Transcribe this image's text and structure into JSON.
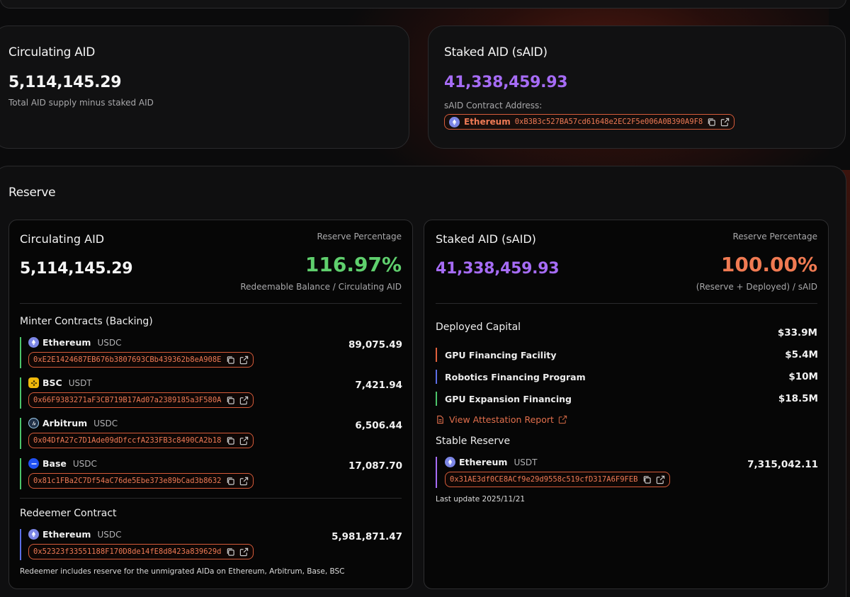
{
  "colors": {
    "accent": "#ee7a55",
    "purple": "#a66cf5",
    "green": "#5fcf6d",
    "orange": "#f07a52",
    "blue": "#5b6ee6"
  },
  "circulating_card": {
    "title": "Circulating AID",
    "value": "5,114,145.29",
    "caption": "Total AID supply minus staked AID"
  },
  "staked_card": {
    "title": "Staked AID (sAID)",
    "value": "41,338,459.93",
    "contract_label": "sAID Contract Address:",
    "chain": "Ethereum",
    "address": "0xB3B3c527BA57cd61648e2EC2F5e006A0B390A9F8"
  },
  "reserve": {
    "title": "Reserve",
    "left": {
      "title": "Circulating AID",
      "value": "5,114,145.29",
      "pct_label": "Reserve Percentage",
      "pct": "116.97%",
      "pct_caption": "Redeemable Balance / Circulating AID",
      "minter_title": "Minter Contracts (Backing)",
      "minters": [
        {
          "chain": "Ethereum",
          "token": "USDC",
          "address": "0xE2E1424687EB676b3807693CBb439362b8eA908E",
          "value": "89,075.49",
          "icon": "ethereum-icon"
        },
        {
          "chain": "BSC",
          "token": "USDT",
          "address": "0x66F9383271aF3CB719B17Ad07a2389185a3F580A",
          "value": "7,421.94",
          "icon": "bsc-icon"
        },
        {
          "chain": "Arbitrum",
          "token": "USDC",
          "address": "0x04DfA27c7D1Ade09dDfccfA233FB3c8490CA2b18",
          "value": "6,506.44",
          "icon": "arbitrum-icon"
        },
        {
          "chain": "Base",
          "token": "USDC",
          "address": "0x81c1FBa2C7Df54aC76de5Ebe373e89bCad3b8632",
          "value": "17,087.70",
          "icon": "base-icon"
        }
      ],
      "redeemer_title": "Redeemer Contract",
      "redeemer": {
        "chain": "Ethereum",
        "token": "USDC",
        "address": "0x52323f33551188F170D8de14fE8d8423a839629d",
        "value": "5,981,871.47"
      },
      "redeemer_note": "Redeemer includes reserve for the unmigrated AIDa on Ethereum, Arbitrum, Base, BSC"
    },
    "right": {
      "title": "Staked AID (sAID)",
      "value": "41,338,459.93",
      "pct_label": "Reserve Percentage",
      "pct": "100.00%",
      "pct_caption": "(Reserve + Deployed) / sAID",
      "deployed_title": "Deployed Capital",
      "deployed_total": "$33.9M",
      "deployed": [
        {
          "name": "GPU Financing Facility",
          "value": "$5.4M",
          "color": "#e0603c"
        },
        {
          "name": "Robotics Financing Program",
          "value": "$10M",
          "color": "#5b6ee6"
        },
        {
          "name": "GPU Expansion Financing",
          "value": "$18.5M",
          "color": "#4cc46a"
        }
      ],
      "attestation_link": "View Attestation Report",
      "stable_title": "Stable Reserve",
      "stable": {
        "chain": "Ethereum",
        "token": "USDT",
        "address": "0x31AE3df0CE8ACf9e29d9558c519cfD317A6F9FEB",
        "value": "7,315,042.11"
      },
      "last_update": "Last update 2025/11/21"
    }
  }
}
